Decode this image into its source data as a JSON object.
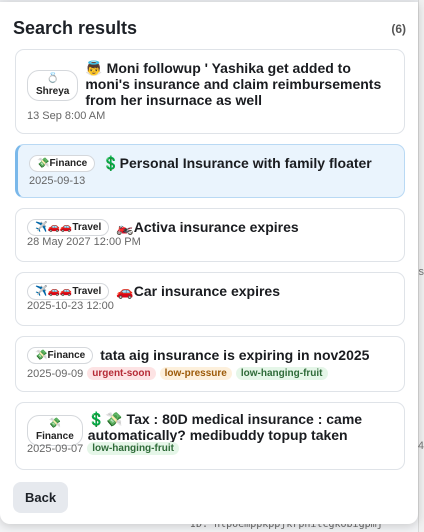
{
  "background": {
    "bottom_text": "ID: hlpoemppkppjkrpnilcgkobigpmj",
    "right_text_1": "s",
    "right_text_2": "4"
  },
  "panel": {
    "title": "Search results",
    "count": "(6)"
  },
  "results": [
    {
      "tag": "💍\nShreya",
      "tag_icon": "💍",
      "tag_label": "Shreya",
      "title": "👼 Moni followup ' Yashika get added to moni's insurance and claim reimbursements from her insurnace as well",
      "date": "13 Sep 8:00 AM",
      "pills": []
    },
    {
      "tag_icon": "💸",
      "tag_label": "Finance",
      "title": "💲Personal Insurance with family floater",
      "date": "2025-09-13",
      "selected": true,
      "pills": []
    },
    {
      "tag_icon": "✈️🚗🚗",
      "tag_label": "Travel",
      "title": "🏍️Activa insurance expires",
      "date": "28 May 2027 12:00 PM",
      "pills": []
    },
    {
      "tag_icon": "✈️🚗🚗",
      "tag_label": "Travel",
      "title": "🚗Car insurance expires",
      "date": "2025-10-23 12:00",
      "pills": []
    },
    {
      "tag_icon": "💸",
      "tag_label": "Finance",
      "title": "tata aig insurance is expiring in nov2025",
      "date": "2025-09-09",
      "pills": [
        "urgent-soon",
        "low-pressure",
        "low-hanging-fruit"
      ]
    },
    {
      "tag_icon": "💸",
      "tag_label": "Finance",
      "title": "💲💸 Tax : 80D medical insurance : came automatically? medibuddy topup taken",
      "date": "2025-09-07",
      "pills": [
        "low-hanging-fruit"
      ]
    }
  ],
  "footer": {
    "back_label": "Back"
  },
  "colors": {
    "selected_bg": "#eaf4fd",
    "selected_border": "#7ab8ea",
    "urgent": "#b52b36",
    "pressure": "#9c5a09",
    "fruit": "#2f6b39"
  }
}
